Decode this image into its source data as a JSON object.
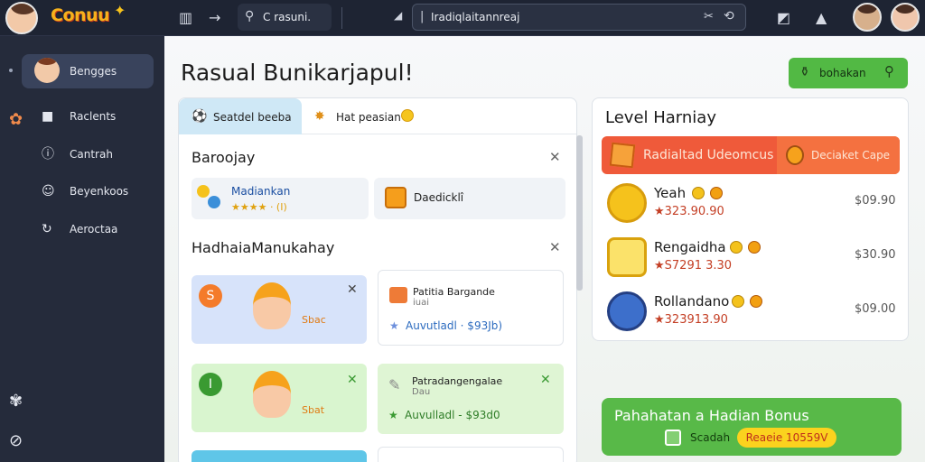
{
  "topbar": {
    "logo_text": "Conuu",
    "search_left": "C rasuni.",
    "search_main": "Iradiqlaitannreaj",
    "icons": [
      "panel-icon",
      "forward-icon",
      "search-icon",
      "arrow-icon",
      "close-icon",
      "refresh-icon",
      "tag-icon",
      "alert-icon"
    ]
  },
  "sidebar": {
    "items": [
      {
        "label": "Bengges",
        "icon": "avatar"
      },
      {
        "label": "Raclents",
        "icon": "square-icon"
      },
      {
        "label": "Cantrah",
        "icon": "info-icon"
      },
      {
        "label": "Beyenkoos",
        "icon": "user-icon"
      },
      {
        "label": "Aeroctaa",
        "icon": "share-icon"
      }
    ]
  },
  "main": {
    "title": "Rasual Bunikarjapul!",
    "top_button_label": "bohakan",
    "panel": {
      "tabs": [
        {
          "label": "Seatdel beeba"
        },
        {
          "label": "Hat peasian"
        }
      ],
      "section1": {
        "title": "Baroojay",
        "chips": [
          {
            "label": "Madiankan",
            "stars": "★★★★ · (I)"
          },
          {
            "label": "Daedicklî"
          }
        ]
      },
      "section2": {
        "title": "HadhaiaManukahay",
        "cards": [
          {
            "badge": "S",
            "tag": "Sbac"
          },
          {
            "title": "Patitia Bargande",
            "sub": "iuai",
            "price": "Auvutladl · $93Jb)"
          },
          {
            "badge": "I",
            "tag": "Sbat"
          },
          {
            "title": "Patradangengalae",
            "sub": "Dau",
            "price": "Auvulladl - $93d0"
          }
        ]
      }
    },
    "level": {
      "title": "Level Harniay",
      "banner_text": "Radialtad Udeomcus",
      "banner_sub": "Deciaket Cape",
      "rows": [
        {
          "name": "Yeah",
          "score": "★323.90.90",
          "price": "$09.90"
        },
        {
          "name": "Rengaidha",
          "score": "★S7291 3.30",
          "price": "$30.90"
        },
        {
          "name": "Rollandano",
          "score": "★323913.90",
          "price": "$09.00"
        }
      ]
    },
    "bonus": {
      "title": "Pahahatan a Hadian Bonus",
      "label": "Scadah",
      "pill": "Reaeie 10559V"
    }
  },
  "colors": {
    "accent_green": "#52b944",
    "accent_red": "#ef5a3a",
    "sidebar_bg": "#252b3b",
    "topbar_bg": "#1e2433"
  }
}
